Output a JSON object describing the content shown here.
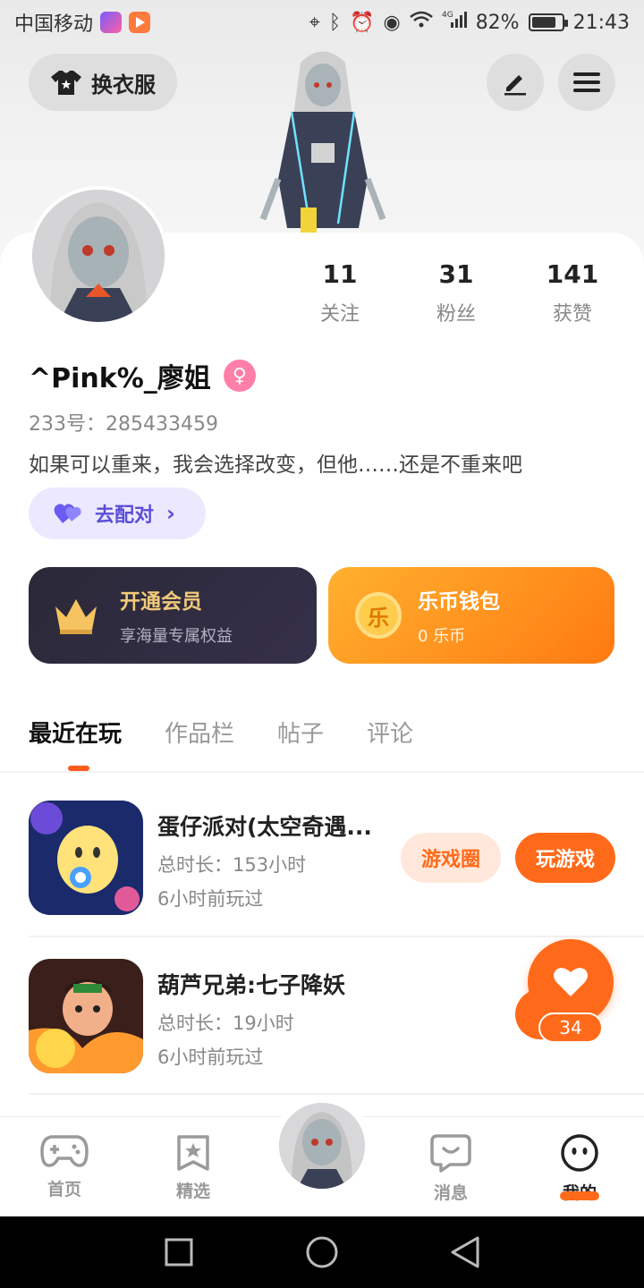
{
  "status_bar": {
    "carrier": "中国移动",
    "battery": "82%",
    "battery_level": 0.82,
    "time": "21:43",
    "network": "4G"
  },
  "header": {
    "change_clothes_label": "换衣服",
    "icons": [
      "shirt-icon",
      "edit-icon",
      "menu-icon"
    ]
  },
  "profile": {
    "stats": [
      {
        "num": "11",
        "label": "关注"
      },
      {
        "num": "31",
        "label": "粉丝"
      },
      {
        "num": "141",
        "label": "获赞"
      }
    ],
    "username": "^Pink%_廖姐",
    "uid": "233号：285433459",
    "bio": "如果可以重来，我会选择改变，但他……还是不重来吧",
    "match_label": "去配对"
  },
  "cards": {
    "vip": {
      "title": "开通会员",
      "subtitle": "享海量专属权益"
    },
    "wallet": {
      "title": "乐币钱包",
      "subtitle": "0 乐币",
      "coin_char": "乐"
    }
  },
  "tabs": [
    {
      "label": "最近在玩",
      "active": true
    },
    {
      "label": "作品栏",
      "active": false
    },
    {
      "label": "帖子",
      "active": false
    },
    {
      "label": "评论",
      "active": false
    }
  ],
  "games": [
    {
      "title": "蛋仔派对(太空奇遇...",
      "duration": "总时长：153小时",
      "last_played": "6小时前玩过",
      "circle_label": "游戏圈",
      "play_label": "玩游戏"
    },
    {
      "title": "葫芦兄弟:七子降妖",
      "duration": "总时长：19小时",
      "last_played": "6小时前玩过"
    }
  ],
  "like": {
    "count": "34"
  },
  "bottom_nav": [
    {
      "label": "首页",
      "icon": "gamepad-icon"
    },
    {
      "label": "精选",
      "icon": "star-bookmark-icon"
    },
    {
      "label": "消息",
      "icon": "chat-smile-icon"
    },
    {
      "label": "我的",
      "icon": "face-icon"
    }
  ],
  "colors": {
    "accent": "#ff6a1a",
    "vip_gold": "#f0c97a",
    "match_purple": "#5b4ed6"
  }
}
